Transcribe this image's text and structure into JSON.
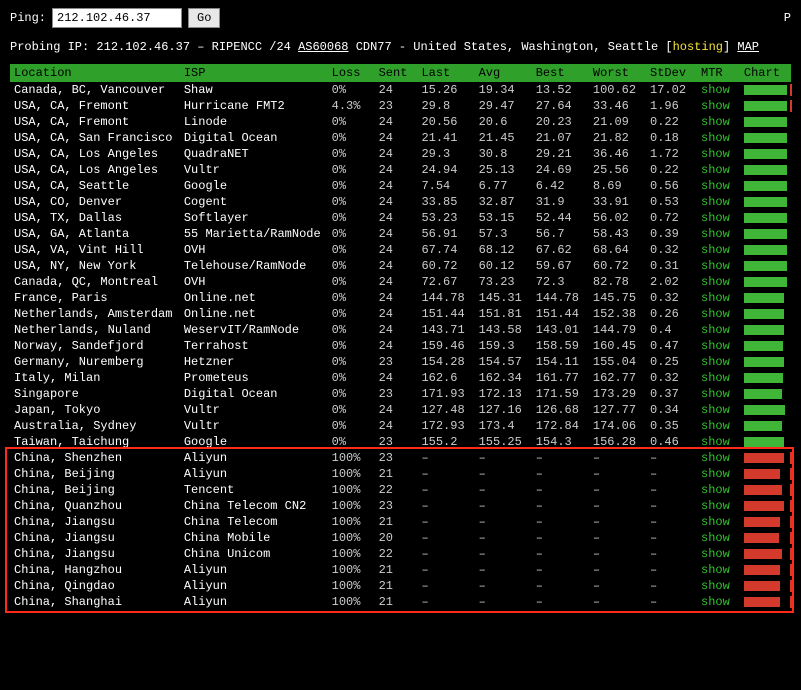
{
  "ping_label": "Ping:",
  "ip_value": "212.102.46.37",
  "go_label": "Go",
  "top_right": "P",
  "probe": {
    "prefix": "Probing IP: ",
    "ip": "212.102.46.37",
    "sep": " – RIPENCC /24 ",
    "asn": "AS60068",
    "cdn": " CDN77 - United States, Washington, Seattle [",
    "hosting": "hosting",
    "close": "] ",
    "map": "MAP"
  },
  "columns": [
    "Location",
    "ISP",
    "Loss",
    "Sent",
    "Last",
    "Avg",
    "Best",
    "Worst",
    "StDev",
    "MTR",
    "Chart"
  ],
  "rows": [
    {
      "loc": "Canada, BC, Vancouver",
      "isp": "Shaw",
      "loss": "0%",
      "sent": "24",
      "last": "15.26",
      "avg": "19.34",
      "best": "13.52",
      "worst": "100.62",
      "stdev": "17.02",
      "bar": 43,
      "color": "green",
      "tick": 46
    },
    {
      "loc": "USA, CA, Fremont",
      "isp": "Hurricane FMT2",
      "loss": "4.3%",
      "sent": "23",
      "last": "29.8",
      "avg": "29.47",
      "best": "27.64",
      "worst": "33.46",
      "stdev": "1.96",
      "bar": 43,
      "color": "green",
      "tick": 46
    },
    {
      "loc": "USA, CA, Fremont",
      "isp": "Linode",
      "loss": "0%",
      "sent": "24",
      "last": "20.56",
      "avg": "20.6",
      "best": "20.23",
      "worst": "21.09",
      "stdev": "0.22",
      "bar": 43,
      "color": "green"
    },
    {
      "loc": "USA, CA, San Francisco",
      "isp": "Digital Ocean",
      "loss": "0%",
      "sent": "24",
      "last": "21.41",
      "avg": "21.45",
      "best": "21.07",
      "worst": "21.82",
      "stdev": "0.18",
      "bar": 43,
      "color": "green"
    },
    {
      "loc": "USA, CA, Los Angeles",
      "isp": "QuadraNET",
      "loss": "0%",
      "sent": "24",
      "last": "29.3",
      "avg": "30.8",
      "best": "29.21",
      "worst": "36.46",
      "stdev": "1.72",
      "bar": 43,
      "color": "green"
    },
    {
      "loc": "USA, CA, Los Angeles",
      "isp": "Vultr",
      "loss": "0%",
      "sent": "24",
      "last": "24.94",
      "avg": "25.13",
      "best": "24.69",
      "worst": "25.56",
      "stdev": "0.22",
      "bar": 43,
      "color": "green"
    },
    {
      "loc": "USA, CA, Seattle",
      "isp": "Google",
      "loss": "0%",
      "sent": "24",
      "last": "7.54",
      "avg": "6.77",
      "best": "6.42",
      "worst": "8.69",
      "stdev": "0.56",
      "bar": 43,
      "color": "green"
    },
    {
      "loc": "USA, CO, Denver",
      "isp": "Cogent",
      "loss": "0%",
      "sent": "24",
      "last": "33.85",
      "avg": "32.87",
      "best": "31.9",
      "worst": "33.91",
      "stdev": "0.53",
      "bar": 43,
      "color": "green"
    },
    {
      "loc": "USA, TX, Dallas",
      "isp": "Softlayer",
      "loss": "0%",
      "sent": "24",
      "last": "53.23",
      "avg": "53.15",
      "best": "52.44",
      "worst": "56.02",
      "stdev": "0.72",
      "bar": 43,
      "color": "green"
    },
    {
      "loc": "USA, GA, Atlanta",
      "isp": "55 Marietta/RamNode",
      "loss": "0%",
      "sent": "24",
      "last": "56.91",
      "avg": "57.3",
      "best": "56.7",
      "worst": "58.43",
      "stdev": "0.39",
      "bar": 43,
      "color": "green"
    },
    {
      "loc": "USA, VA, Vint Hill",
      "isp": "OVH",
      "loss": "0%",
      "sent": "24",
      "last": "67.74",
      "avg": "68.12",
      "best": "67.62",
      "worst": "68.64",
      "stdev": "0.32",
      "bar": 43,
      "color": "green"
    },
    {
      "loc": "USA, NY, New York",
      "isp": "Telehouse/RamNode",
      "loss": "0%",
      "sent": "24",
      "last": "60.72",
      "avg": "60.12",
      "best": "59.67",
      "worst": "60.72",
      "stdev": "0.31",
      "bar": 43,
      "color": "green"
    },
    {
      "loc": "Canada, QC, Montreal",
      "isp": "OVH",
      "loss": "0%",
      "sent": "24",
      "last": "72.67",
      "avg": "73.23",
      "best": "72.3",
      "worst": "82.78",
      "stdev": "2.02",
      "bar": 43,
      "color": "green"
    },
    {
      "loc": "France, Paris",
      "isp": "Online.net",
      "loss": "0%",
      "sent": "24",
      "last": "144.78",
      "avg": "145.31",
      "best": "144.78",
      "worst": "145.75",
      "stdev": "0.32",
      "bar": 40,
      "color": "green"
    },
    {
      "loc": "Netherlands, Amsterdam",
      "isp": "Online.net",
      "loss": "0%",
      "sent": "24",
      "last": "151.44",
      "avg": "151.81",
      "best": "151.44",
      "worst": "152.38",
      "stdev": "0.26",
      "bar": 40,
      "color": "green"
    },
    {
      "loc": "Netherlands, Nuland",
      "isp": "WeservIT/RamNode",
      "loss": "0%",
      "sent": "24",
      "last": "143.71",
      "avg": "143.58",
      "best": "143.01",
      "worst": "144.79",
      "stdev": "0.4",
      "bar": 40,
      "color": "green"
    },
    {
      "loc": "Norway, Sandefjord",
      "isp": "Terrahost",
      "loss": "0%",
      "sent": "24",
      "last": "159.46",
      "avg": "159.3",
      "best": "158.59",
      "worst": "160.45",
      "stdev": "0.47",
      "bar": 39,
      "color": "green"
    },
    {
      "loc": "Germany, Nuremberg",
      "isp": "Hetzner",
      "loss": "0%",
      "sent": "23",
      "last": "154.28",
      "avg": "154.57",
      "best": "154.11",
      "worst": "155.04",
      "stdev": "0.25",
      "bar": 40,
      "color": "green"
    },
    {
      "loc": "Italy, Milan",
      "isp": "Prometeus",
      "loss": "0%",
      "sent": "24",
      "last": "162.6",
      "avg": "162.34",
      "best": "161.77",
      "worst": "162.77",
      "stdev": "0.32",
      "bar": 39,
      "color": "green"
    },
    {
      "loc": "Singapore",
      "isp": "Digital Ocean",
      "loss": "0%",
      "sent": "23",
      "last": "171.93",
      "avg": "172.13",
      "best": "171.59",
      "worst": "173.29",
      "stdev": "0.37",
      "bar": 38,
      "color": "green"
    },
    {
      "loc": "Japan, Tokyo",
      "isp": "Vultr",
      "loss": "0%",
      "sent": "24",
      "last": "127.48",
      "avg": "127.16",
      "best": "126.68",
      "worst": "127.77",
      "stdev": "0.34",
      "bar": 41,
      "color": "green"
    },
    {
      "loc": "Australia, Sydney",
      "isp": "Vultr",
      "loss": "0%",
      "sent": "24",
      "last": "172.93",
      "avg": "173.4",
      "best": "172.84",
      "worst": "174.06",
      "stdev": "0.35",
      "bar": 38,
      "color": "green"
    },
    {
      "loc": "Taiwan, Taichung",
      "isp": "Google",
      "loss": "0%",
      "sent": "23",
      "last": "155.2",
      "avg": "155.25",
      "best": "154.3",
      "worst": "156.28",
      "stdev": "0.46",
      "bar": 40,
      "color": "green"
    },
    {
      "loc": "China, Shenzhen",
      "isp": "Aliyun",
      "loss": "100%",
      "sent": "23",
      "last": "–",
      "avg": "–",
      "best": "–",
      "worst": "–",
      "stdev": "–",
      "bar": 40,
      "color": "red",
      "tick": 46
    },
    {
      "loc": "China, Beijing",
      "isp": "Aliyun",
      "loss": "100%",
      "sent": "21",
      "last": "–",
      "avg": "–",
      "best": "–",
      "worst": "–",
      "stdev": "–",
      "bar": 36,
      "color": "red",
      "tick": 46
    },
    {
      "loc": "China, Beijing",
      "isp": "Tencent",
      "loss": "100%",
      "sent": "22",
      "last": "–",
      "avg": "–",
      "best": "–",
      "worst": "–",
      "stdev": "–",
      "bar": 38,
      "color": "red",
      "tick": 46
    },
    {
      "loc": "China, Quanzhou",
      "isp": "China Telecom CN2",
      "loss": "100%",
      "sent": "23",
      "last": "–",
      "avg": "–",
      "best": "–",
      "worst": "–",
      "stdev": "–",
      "bar": 40,
      "color": "red",
      "tick": 46
    },
    {
      "loc": "China, Jiangsu",
      "isp": "China Telecom",
      "loss": "100%",
      "sent": "21",
      "last": "–",
      "avg": "–",
      "best": "–",
      "worst": "–",
      "stdev": "–",
      "bar": 36,
      "color": "red",
      "tick": 46
    },
    {
      "loc": "China, Jiangsu",
      "isp": "China Mobile",
      "loss": "100%",
      "sent": "20",
      "last": "–",
      "avg": "–",
      "best": "–",
      "worst": "–",
      "stdev": "–",
      "bar": 35,
      "color": "red",
      "tick": 46
    },
    {
      "loc": "China, Jiangsu",
      "isp": "China Unicom",
      "loss": "100%",
      "sent": "22",
      "last": "–",
      "avg": "–",
      "best": "–",
      "worst": "–",
      "stdev": "–",
      "bar": 38,
      "color": "red",
      "tick": 46
    },
    {
      "loc": "China, Hangzhou",
      "isp": "Aliyun",
      "loss": "100%",
      "sent": "21",
      "last": "–",
      "avg": "–",
      "best": "–",
      "worst": "–",
      "stdev": "–",
      "bar": 36,
      "color": "red",
      "tick": 46
    },
    {
      "loc": "China, Qingdao",
      "isp": "Aliyun",
      "loss": "100%",
      "sent": "21",
      "last": "–",
      "avg": "–",
      "best": "–",
      "worst": "–",
      "stdev": "–",
      "bar": 36,
      "color": "red",
      "tick": 46
    },
    {
      "loc": "China, Shanghai",
      "isp": "Aliyun",
      "loss": "100%",
      "sent": "21",
      "last": "–",
      "avg": "–",
      "best": "–",
      "worst": "–",
      "stdev": "–",
      "bar": 36,
      "color": "red",
      "tick": 46
    }
  ],
  "mtr_label": "show"
}
